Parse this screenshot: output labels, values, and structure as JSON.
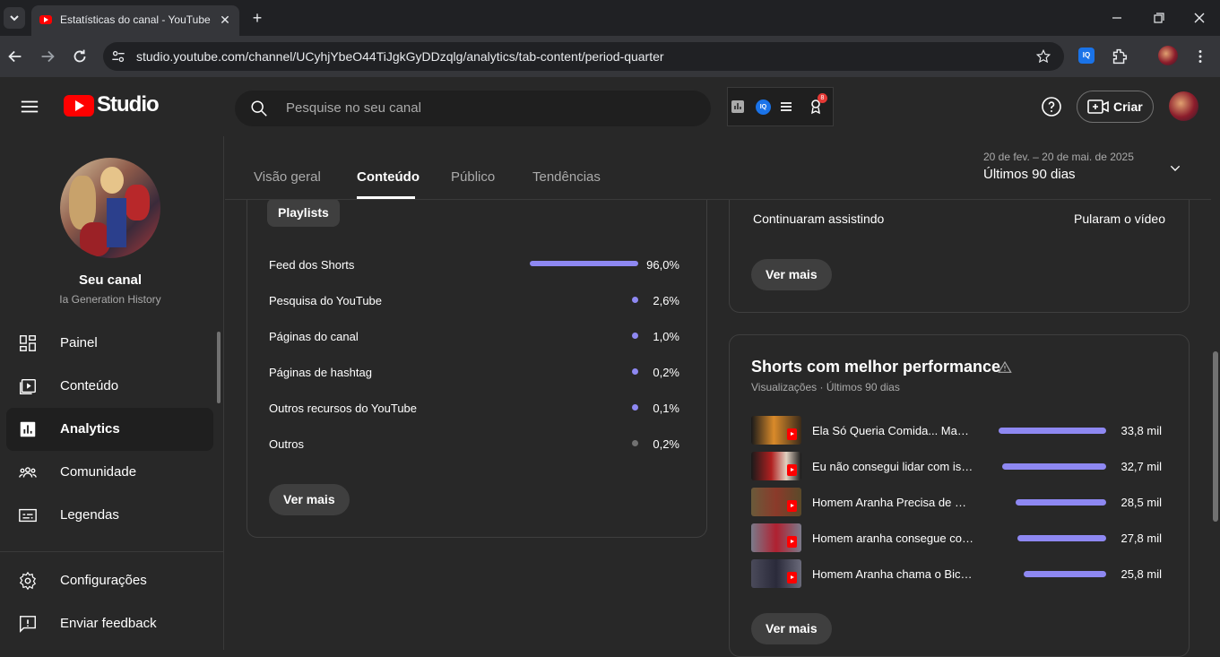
{
  "browser": {
    "tab_title": "Estatísticas do canal - YouTube Studio",
    "url": "studio.youtube.com/channel/UCyhjYbeO44TiJgkGyDDzqlg/analytics/tab-content/period-quarter"
  },
  "header": {
    "logo_text": "Studio",
    "search_placeholder": "Pesquise no seu canal",
    "create_label": "Criar",
    "notification_count": "8"
  },
  "sidebar": {
    "channel_name": "Seu canal",
    "channel_subtitle": "Ia Generation History",
    "items": [
      {
        "label": "Painel",
        "icon": "dashboard-icon"
      },
      {
        "label": "Conteúdo",
        "icon": "content-icon"
      },
      {
        "label": "Analytics",
        "icon": "analytics-icon",
        "active": true
      },
      {
        "label": "Comunidade",
        "icon": "community-icon"
      },
      {
        "label": "Legendas",
        "icon": "subtitles-icon"
      }
    ],
    "bottom_items": [
      {
        "label": "Configurações",
        "icon": "gear-icon"
      },
      {
        "label": "Enviar feedback",
        "icon": "feedback-icon"
      }
    ]
  },
  "tabs": [
    "Visão geral",
    "Conteúdo",
    "Público",
    "Tendências"
  ],
  "active_tab": "Conteúdo",
  "period": {
    "date_range": "20 de fev. – 20 de mai. de 2025",
    "label": "Últimos 90 dias"
  },
  "traffic_card": {
    "chip_label": "Playlists",
    "rows": [
      {
        "label": "Feed dos Shorts",
        "value": "96,0%",
        "share": 0.96
      },
      {
        "label": "Pesquisa do YouTube",
        "value": "2,6%",
        "share": 0.026
      },
      {
        "label": "Páginas do canal",
        "value": "1,0%",
        "share": 0.01
      },
      {
        "label": "Páginas de hashtag",
        "value": "0,2%",
        "share": 0.002
      },
      {
        "label": "Outros recursos do YouTube",
        "value": "0,1%",
        "share": 0.001
      },
      {
        "label": "Outros",
        "value": "0,2%",
        "share": 0.002,
        "grey": true
      }
    ],
    "more_label": "Ver mais"
  },
  "retention_card": {
    "left_label": "Continuaram assistindo",
    "right_label": "Pularam o vídeo",
    "more_label": "Ver mais"
  },
  "shorts_card": {
    "title": "Shorts com melhor performance",
    "subtitle": "Visualizações · Últimos 90 dias",
    "rows": [
      {
        "title": "Ela Só Queria Comida... Mas O Hulk Salvou o Dia!",
        "value": "33,8 mil",
        "views": 33.8
      },
      {
        "title": "Eu não consegui lidar com isso...",
        "value": "32,7 mil",
        "views": 32.7
      },
      {
        "title": "Homem Aranha Precisa de Sua Ajuda!",
        "value": "28,5 mil",
        "views": 28.5
      },
      {
        "title": "Homem aranha consegue consertar isso?",
        "value": "27,8 mil",
        "views": 27.8
      },
      {
        "title": "Homem Aranha chama o Bicho!",
        "value": "25,8 mil",
        "views": 25.8
      }
    ],
    "more_label": "Ver mais"
  },
  "colors": {
    "accent": "#8e88f2",
    "brand_red": "#ff0000",
    "background": "#282828"
  }
}
